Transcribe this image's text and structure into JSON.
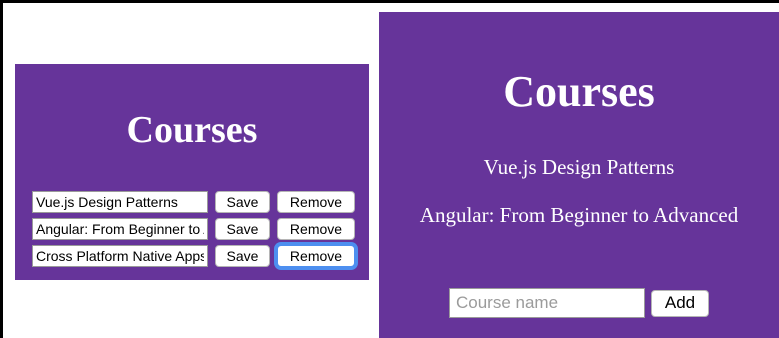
{
  "left": {
    "title": "Courses",
    "rows": [
      {
        "value": "Vue.js Design Patterns",
        "save_label": "Save",
        "remove_label": "Remove"
      },
      {
        "value": "Angular: From Beginner to Advanced",
        "save_label": "Save",
        "remove_label": "Remove"
      },
      {
        "value": "Cross Platform Native Apps",
        "save_label": "Save",
        "remove_label": "Remove"
      }
    ]
  },
  "right": {
    "title": "Courses",
    "courses": [
      "Vue.js Design Patterns",
      "Angular: From Beginner to Advanced"
    ],
    "input_placeholder": "Course name",
    "add_label": "Add"
  },
  "colors": {
    "panel_bg": "#66349a",
    "focus_ring": "#4d8ff0"
  }
}
